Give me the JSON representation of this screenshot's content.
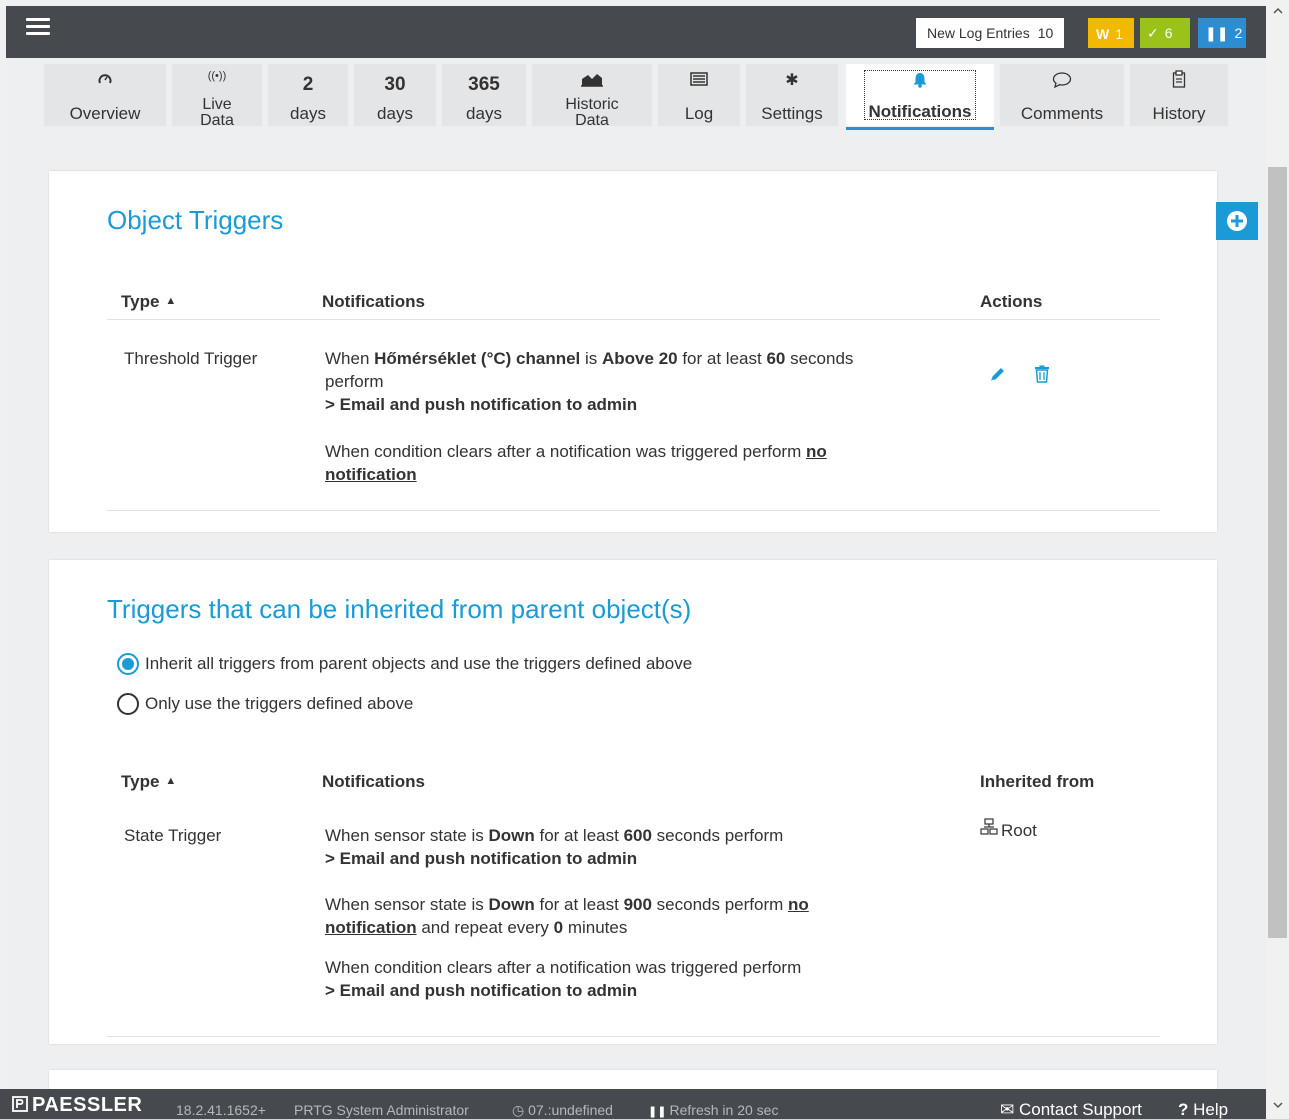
{
  "topbar": {
    "log_label": "New Log Entries",
    "log_count": "10",
    "warning_label": "W",
    "warning_count": "1",
    "ok_count": "6",
    "paused_count": "2"
  },
  "tabs": [
    {
      "icon": "gauge-icon",
      "label": "Overview"
    },
    {
      "icon": "live-icon",
      "label1": "Live",
      "label2": "Data"
    },
    {
      "num": "2",
      "label": "days"
    },
    {
      "num": "30",
      "label": "days"
    },
    {
      "num": "365",
      "label": "days"
    },
    {
      "icon": "chart-icon",
      "label1": "Historic",
      "label2": "Data"
    },
    {
      "icon": "log-icon",
      "label": "Log"
    },
    {
      "icon": "gear-icon",
      "label": "Settings"
    },
    {
      "icon": "bell-icon",
      "label": "Notifications"
    },
    {
      "icon": "comment-icon",
      "label": "Comments"
    },
    {
      "icon": "history-icon",
      "label": "History"
    }
  ],
  "object_triggers": {
    "title": "Object Triggers",
    "col_type": "Type",
    "col_notifications": "Notifications",
    "col_actions": "Actions",
    "row": {
      "type": "Threshold Trigger",
      "l1_a": "When ",
      "l1_channel": "Hőmérséklet (°C) channel",
      "l1_b": " is ",
      "l1_cond": "Above 20",
      "l1_c": " for at least ",
      "l1_secs": "60",
      "l1_d": " seconds",
      "l2": "perform",
      "l3": "> Email and push notification to admin",
      "l4_a": "When condition clears after a notification was triggered perform ",
      "l4_link1": "no",
      "l4_link2": "notification"
    }
  },
  "inherited_triggers": {
    "title": "Triggers that can be inherited from parent object(s)",
    "radio_inherit": "Inherit all triggers from parent objects and use the triggers defined above",
    "radio_only": "Only use the triggers defined above",
    "col_type": "Type",
    "col_notifications": "Notifications",
    "col_inherited": "Inherited from",
    "row": {
      "type": "State Trigger",
      "inherited_from": "Root",
      "b1_a": "When sensor state is ",
      "b1_state": "Down",
      "b1_b": " for at least ",
      "b1_secs": "600",
      "b1_c": " seconds perform",
      "b1_action": "> Email and push notification to admin",
      "b2_a": "When sensor state is ",
      "b2_state": "Down",
      "b2_b": " for at least ",
      "b2_secs": "900",
      "b2_c": " seconds perform ",
      "b2_link1": "no",
      "b2_link2": "notification",
      "b2_d": " and repeat every ",
      "b2_mins": "0",
      "b2_e": " minutes",
      "b3_a": "When condition clears after a notification was triggered perform",
      "b3_action": "> Email and push notification to admin"
    }
  },
  "footer": {
    "logo": "PAESSLER",
    "version": "18.2.41.1652+",
    "user": "PRTG System Administrator",
    "time": "07.:undefined",
    "refresh": "Refresh in 20 sec",
    "contact": "Contact Support",
    "help": "Help"
  },
  "colors": {
    "accent": "#1a9ad6",
    "warning": "#f2b900",
    "ok": "#9ac21b",
    "paused": "#2d8dd2",
    "topbar": "#464a4e"
  }
}
